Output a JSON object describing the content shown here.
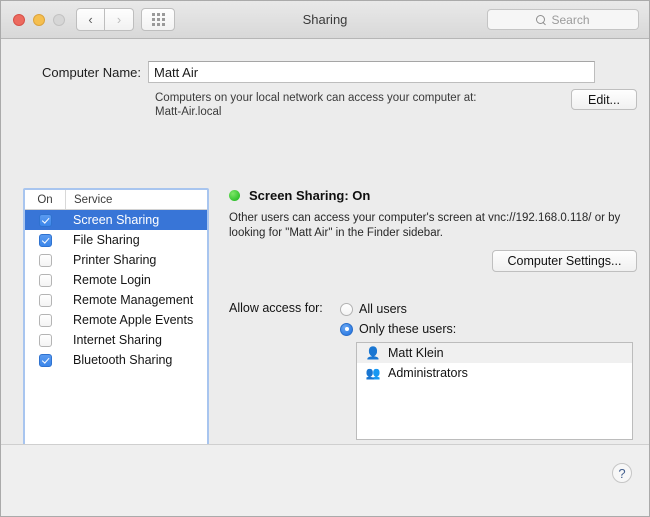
{
  "window": {
    "title": "Sharing",
    "traffic_lights": [
      "close",
      "minimize",
      "zoom"
    ],
    "nav_back_icon": "chevron-left-icon",
    "nav_forward_icon": "chevron-right-icon",
    "grid_icon": "show-all-grid-icon"
  },
  "search": {
    "placeholder": "Search",
    "icon": "search-icon"
  },
  "computer_name": {
    "label": "Computer Name:",
    "value": "Matt Air",
    "hint_line1": "Computers on your local network can access your computer at:",
    "hint_line2": "Matt-Air.local",
    "edit_button": "Edit..."
  },
  "services": {
    "header_on": "On",
    "header_service": "Service",
    "items": [
      {
        "name": "Screen Sharing",
        "checked": true,
        "selected": true
      },
      {
        "name": "File Sharing",
        "checked": true,
        "selected": false
      },
      {
        "name": "Printer Sharing",
        "checked": false,
        "selected": false
      },
      {
        "name": "Remote Login",
        "checked": false,
        "selected": false
      },
      {
        "name": "Remote Management",
        "checked": false,
        "selected": false
      },
      {
        "name": "Remote Apple Events",
        "checked": false,
        "selected": false
      },
      {
        "name": "Internet Sharing",
        "checked": false,
        "selected": false
      },
      {
        "name": "Bluetooth Sharing",
        "checked": true,
        "selected": false
      }
    ]
  },
  "detail": {
    "status_text": "Screen Sharing: On",
    "status_color": "#32c22e",
    "status_icon": "status-dot-icon",
    "description": "Other users can access your computer's screen at vnc://192.168.0.118/ or by looking for \"Matt Air\" in the Finder sidebar.",
    "computer_settings_button": "Computer Settings..."
  },
  "access": {
    "label": "Allow access for:",
    "options": [
      {
        "label": "All users",
        "selected": false
      },
      {
        "label": "Only these users:",
        "selected": true
      }
    ],
    "users": [
      {
        "name": "Matt Klein",
        "icon": "single-user-icon",
        "highlighted": true
      },
      {
        "name": "Administrators",
        "icon": "group-users-icon",
        "highlighted": false
      }
    ],
    "add_button": "+",
    "remove_button": "—"
  },
  "help": {
    "label": "?",
    "icon": "help-icon"
  },
  "colors": {
    "accent_blue": "#3875d7",
    "checkbox_blue": "#3b86ea",
    "status_green": "#32c22e",
    "focus_ring": "#a8c5ef",
    "window_bg": "#ececec"
  }
}
